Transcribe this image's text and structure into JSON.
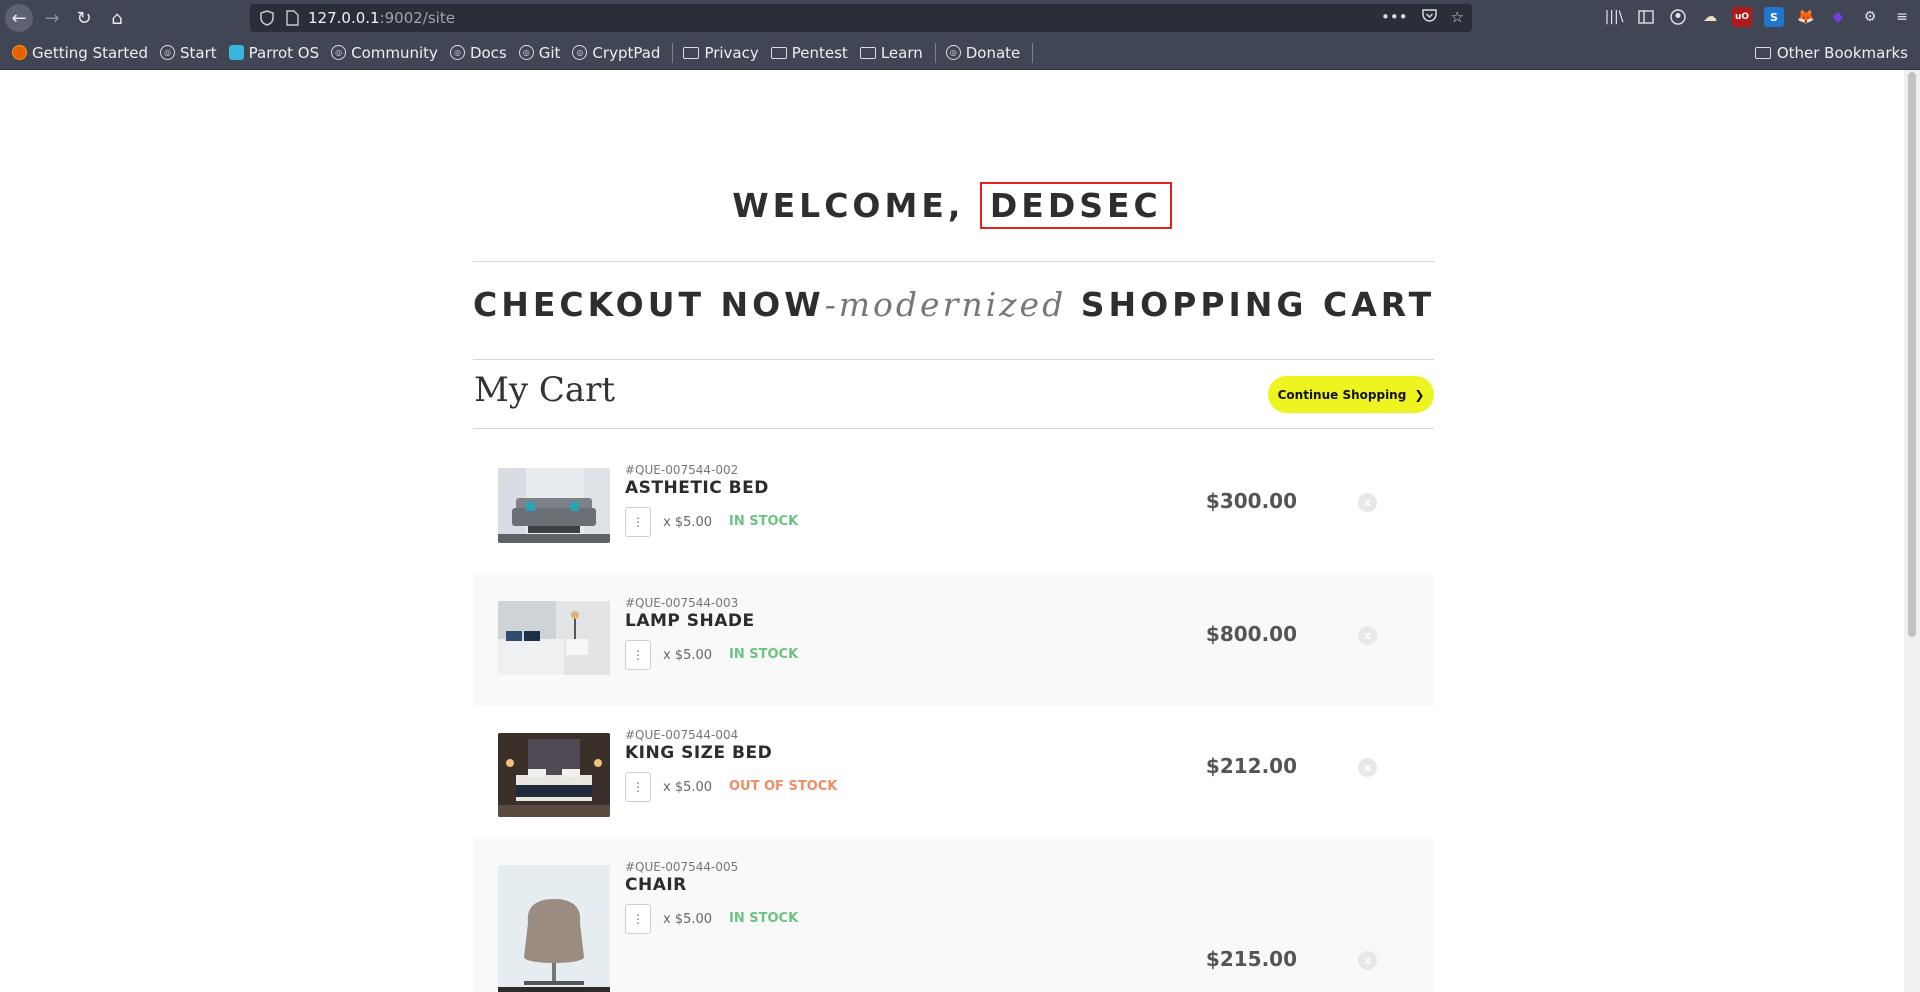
{
  "browser": {
    "url_host": "127.0.0.1",
    "url_rest": ":9002/site",
    "bookmarks": [
      {
        "label": "Getting Started",
        "icon": "firefox-icon"
      },
      {
        "label": "Start",
        "icon": "globe-icon"
      },
      {
        "label": "Parrot OS",
        "icon": "parrot-icon"
      },
      {
        "label": "Community",
        "icon": "globe-icon"
      },
      {
        "label": "Docs",
        "icon": "globe-icon"
      },
      {
        "label": "Git",
        "icon": "globe-icon"
      },
      {
        "label": "CryptPad",
        "icon": "globe-icon"
      },
      {
        "label": "Privacy",
        "icon": "folder-icon"
      },
      {
        "label": "Pentest",
        "icon": "folder-icon"
      },
      {
        "label": "Learn",
        "icon": "folder-icon"
      },
      {
        "label": "Donate",
        "icon": "globe-icon"
      }
    ],
    "other_bookmarks": "Other Bookmarks"
  },
  "page": {
    "welcome_prefix": "WELCOME,",
    "username": "DEDSEC",
    "subhead_left": "CHECKOUT NOW",
    "subhead_mid": "-modernized",
    "subhead_right": "SHOPPING CART",
    "cart_title": "My Cart",
    "continue_label": "Continue Shopping",
    "continue_icon": "❯"
  },
  "cart": {
    "items": [
      {
        "sku": "#QUE-007544-002",
        "name": "ASTHETIC BED",
        "unit": "x $5.00",
        "stock": "IN STOCK",
        "price": "$300.00"
      },
      {
        "sku": "#QUE-007544-003",
        "name": "LAMP SHADE",
        "unit": "x $5.00",
        "stock": "IN STOCK",
        "price": "$800.00"
      },
      {
        "sku": "#QUE-007544-004",
        "name": "KING SIZE BED",
        "unit": "x $5.00",
        "stock": "OUT OF STOCK",
        "price": "$212.00"
      },
      {
        "sku": "#QUE-007544-005",
        "name": "CHAIR",
        "unit": "x $5.00",
        "stock": "IN STOCK",
        "price": "$215.00"
      }
    ],
    "colors": {
      "in_stock": "#6bc281",
      "out_of_stock": "#f38b63",
      "accent": "#eef41f"
    }
  }
}
